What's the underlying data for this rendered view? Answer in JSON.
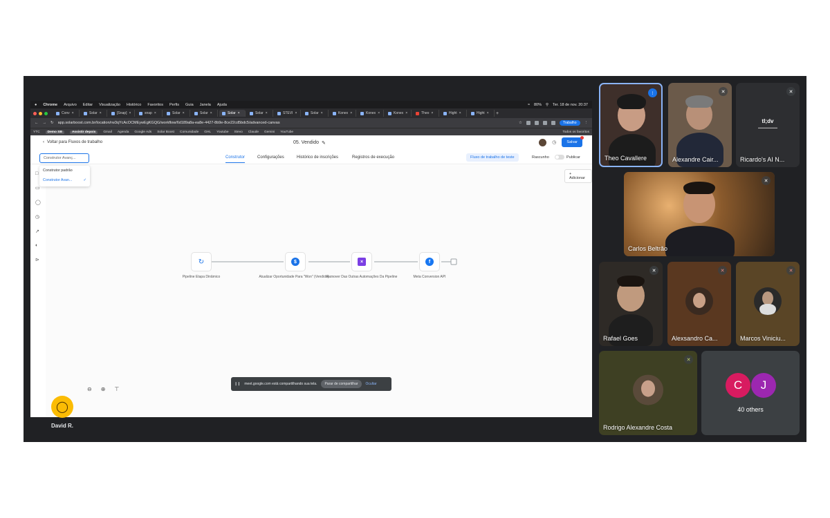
{
  "mac_menu": {
    "app": "Chrome",
    "items": [
      "Arquivo",
      "Editar",
      "Visualização",
      "Histórico",
      "Favoritos",
      "Perfis",
      "Guia",
      "Janela",
      "Ajuda"
    ],
    "battery": "80%",
    "datetime": "Ter. 18 de nov.  20:37"
  },
  "browser": {
    "tabs": [
      "Conv",
      "Solar",
      "[Snap]",
      "snap",
      "Solar",
      "Solar",
      "Solar",
      "Solar",
      "STEVI",
      "Solar",
      "Konex",
      "Konex",
      "Konex",
      "Theo",
      "Hight",
      "Hight"
    ],
    "active_tab_index": 6,
    "url": "app.solarboost.com.br/location/rw3qYcAcOCMEywEgKGQG/workflow/6d189a8a-ea8e-4427-8b9e-8ce22cd5bdc5/advanced-canvas",
    "profile": "Trabalho",
    "bookmarks": [
      "YTC",
      "Demo SB",
      "Assistir depois",
      "Gmail",
      "Agenda",
      "Google Ads",
      "Solar Boost",
      "Comunidade",
      "GHL",
      "Youtube",
      "Stevo",
      "Claude",
      "Gemini",
      "YouTube"
    ],
    "all_favorites": "Todos os favoritos"
  },
  "app": {
    "back_label": "Voltar para Fluxos de trabalho",
    "workflow_name": "05. Vendido",
    "save_label": "Salvar",
    "nav_tabs": [
      "Construtor",
      "Configurações",
      "Histórico de inscrições",
      "Registros de execução"
    ],
    "test_button": "Fluxo de trabalho de teste",
    "draft_label": "Rascunho",
    "publish_label": "Publicar",
    "builder_select": "Construtor Avanç...",
    "builder_options": [
      "Construtor padrão",
      "Construtor Avan..."
    ],
    "add_label": "Adicionar",
    "nodes": [
      {
        "label": "Pipeline Etapa Dinâmico",
        "icon": "refresh-icon",
        "color": "#1a73e8"
      },
      {
        "label": "Atualizar Oportunidade Para \"Won\" (Vendido)...",
        "icon": "dollar-icon",
        "color": "#1a73e8"
      },
      {
        "label": "Remover Das Outras Automações Da Pipeline",
        "icon": "remove-workflow-icon",
        "color": "#7b3fe4"
      },
      {
        "label": "Meta Conversion API",
        "icon": "facebook-icon",
        "color": "#1877f2"
      }
    ]
  },
  "share_banner": {
    "text": "meet.google.com está compartilhando sua tela.",
    "stop_label": "Parar de compartilhar",
    "hide_label": "Ocultar"
  },
  "presenter": {
    "name": "David R."
  },
  "participants": [
    {
      "name": "Theo Cavallere",
      "speaking": true
    },
    {
      "name": "Alexandre Cair...",
      "muted": true
    },
    {
      "name": "Ricardo's AI N...",
      "muted": true
    },
    {
      "name": "Carlos Beltrão",
      "muted": true
    },
    {
      "name": "Rafael Goes",
      "muted": true
    },
    {
      "name": "Alexsandro Ca...",
      "muted": true
    },
    {
      "name": "Marcos Viniciu...",
      "muted": true
    },
    {
      "name": "Rodrigo Alexandre Costa",
      "muted": true
    }
  ],
  "others": {
    "initials": [
      "C",
      "J"
    ],
    "colors": [
      "#d81b60",
      "#9c27b0"
    ],
    "count_label": "40 others"
  },
  "tldv": {
    "logo": "tl;dv"
  }
}
